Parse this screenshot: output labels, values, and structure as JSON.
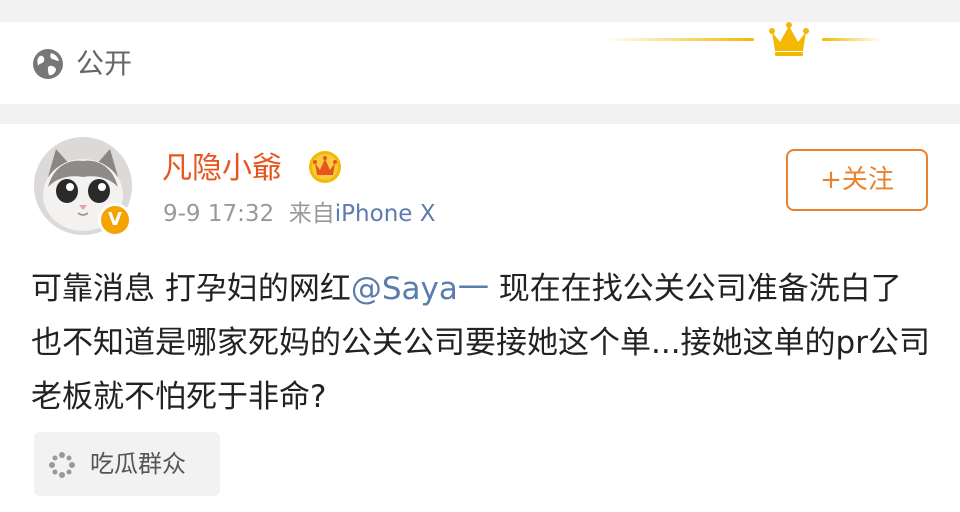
{
  "visibility": {
    "label": "公开",
    "icon": "globe-icon"
  },
  "post": {
    "username": "凡隐小爺",
    "timestamp": "9-9 17:32",
    "source_prefix": "来自",
    "source": "iPhone X",
    "follow_label": "+关注",
    "text_before": "可靠消息 打孕妇的网红",
    "mention": "@Saya一",
    "text_after": " 现在在找公关公司准备洗白了 也不知道是哪家死妈的公关公司要接她这个单...接她这单的pr公司老板就不怕死于非命?",
    "verified_badge": "V"
  },
  "topic": {
    "label": "吃瓜群众",
    "icon": "sparkle-icon"
  },
  "colors": {
    "username": "#e8541e",
    "link": "#5b7cae",
    "follow": "#e8822e",
    "gold": "#f5b800"
  }
}
